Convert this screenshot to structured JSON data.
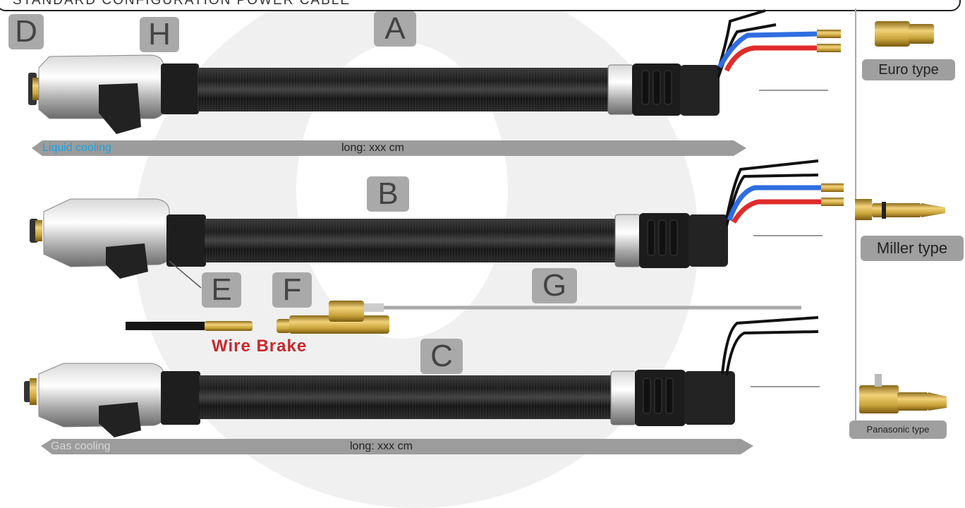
{
  "header": {
    "title": "STANDARD CONFIGURATION POWER CABLE"
  },
  "labels": {
    "A": "A",
    "B": "B",
    "C": "C",
    "D": "D",
    "E": "E",
    "F": "F",
    "G": "G",
    "H": "H"
  },
  "cable_a": {
    "cooling": "Liquid cooling",
    "length": "long: xxx cm"
  },
  "cable_c": {
    "cooling": "Gas cooling",
    "length": "long: xxx cm"
  },
  "wire_brake": "Wire Brake",
  "types": {
    "euro": "Euro type",
    "miller": "Miller type",
    "panasonic": "Panasonic type"
  },
  "colors": {
    "label_bg": "#a9a9a9",
    "arrow": "#9c9c9c",
    "liquid": "#1aa3e0",
    "gas": "#d6d6d6",
    "brake": "#c8282e",
    "brass": "#c9a43a"
  }
}
